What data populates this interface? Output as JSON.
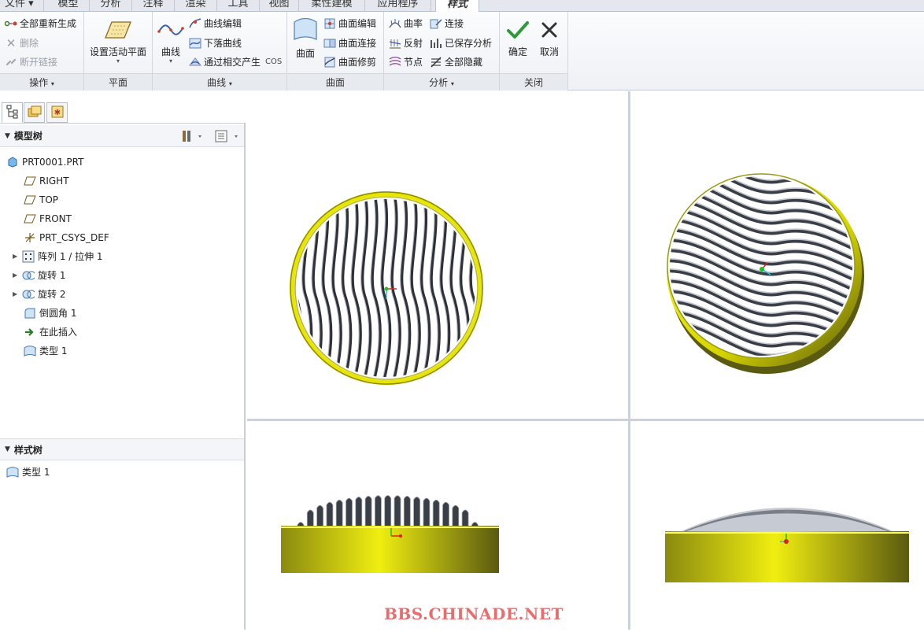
{
  "tabs": [
    "文件",
    "模型",
    "分析",
    "注释",
    "渲染",
    "工具",
    "视图",
    "柔性建模",
    "应用程序",
    "样式"
  ],
  "active_tab": "样式",
  "ribbon": {
    "ops": {
      "regen_all": "全部重新生成",
      "delete": "删除",
      "break_link": "断开链接",
      "label": "操作"
    },
    "plane": {
      "set_active_plane": "设置活动平面",
      "label": "平面"
    },
    "curve": {
      "curve": "曲线",
      "curve_edit": "曲线编辑",
      "drop_curve": "下落曲线",
      "intersect_cos": "通过相交产生",
      "cos": "COS",
      "label": "曲线"
    },
    "surface": {
      "surface": "曲面",
      "surface_edit": "曲面编辑",
      "surface_connect": "曲面连接",
      "surface_trim": "曲面修剪",
      "label": "曲面"
    },
    "analysis": {
      "curvature": "曲率",
      "connect": "连接",
      "reflect": "反射",
      "saved_analysis": "已保存分析",
      "node": "节点",
      "hide_all": "全部隐藏",
      "label": "分析"
    },
    "close": {
      "ok": "确定",
      "cancel": "取消",
      "label": "关闭"
    }
  },
  "model_tree": {
    "title": "模型树",
    "items": [
      {
        "label": "PRT0001.PRT",
        "icon": "part-icon"
      },
      {
        "label": "RIGHT",
        "icon": "datum-plane-icon"
      },
      {
        "label": "TOP",
        "icon": "datum-plane-icon"
      },
      {
        "label": "FRONT",
        "icon": "datum-plane-icon"
      },
      {
        "label": "PRT_CSYS_DEF",
        "icon": "csys-icon"
      },
      {
        "label": "阵列 1 / 拉伸 1",
        "icon": "pattern-icon"
      },
      {
        "label": "旋转 1",
        "icon": "revolve-icon"
      },
      {
        "label": "旋转 2",
        "icon": "revolve-icon"
      },
      {
        "label": "倒圆角 1",
        "icon": "round-icon"
      },
      {
        "label": "在此插入",
        "icon": "insert-here-icon"
      },
      {
        "label": "类型 1",
        "icon": "style-icon"
      }
    ]
  },
  "style_tree": {
    "title": "样式树",
    "items": [
      {
        "label": "类型 1",
        "icon": "style-icon"
      }
    ]
  },
  "colors": {
    "rim_yellow": "#e8e600",
    "rim_dark": "#5a5a10",
    "rib_gray": "#4a4e56",
    "rib_light": "#b8bcc4"
  },
  "watermark": "BBS.CHINADE.NET"
}
